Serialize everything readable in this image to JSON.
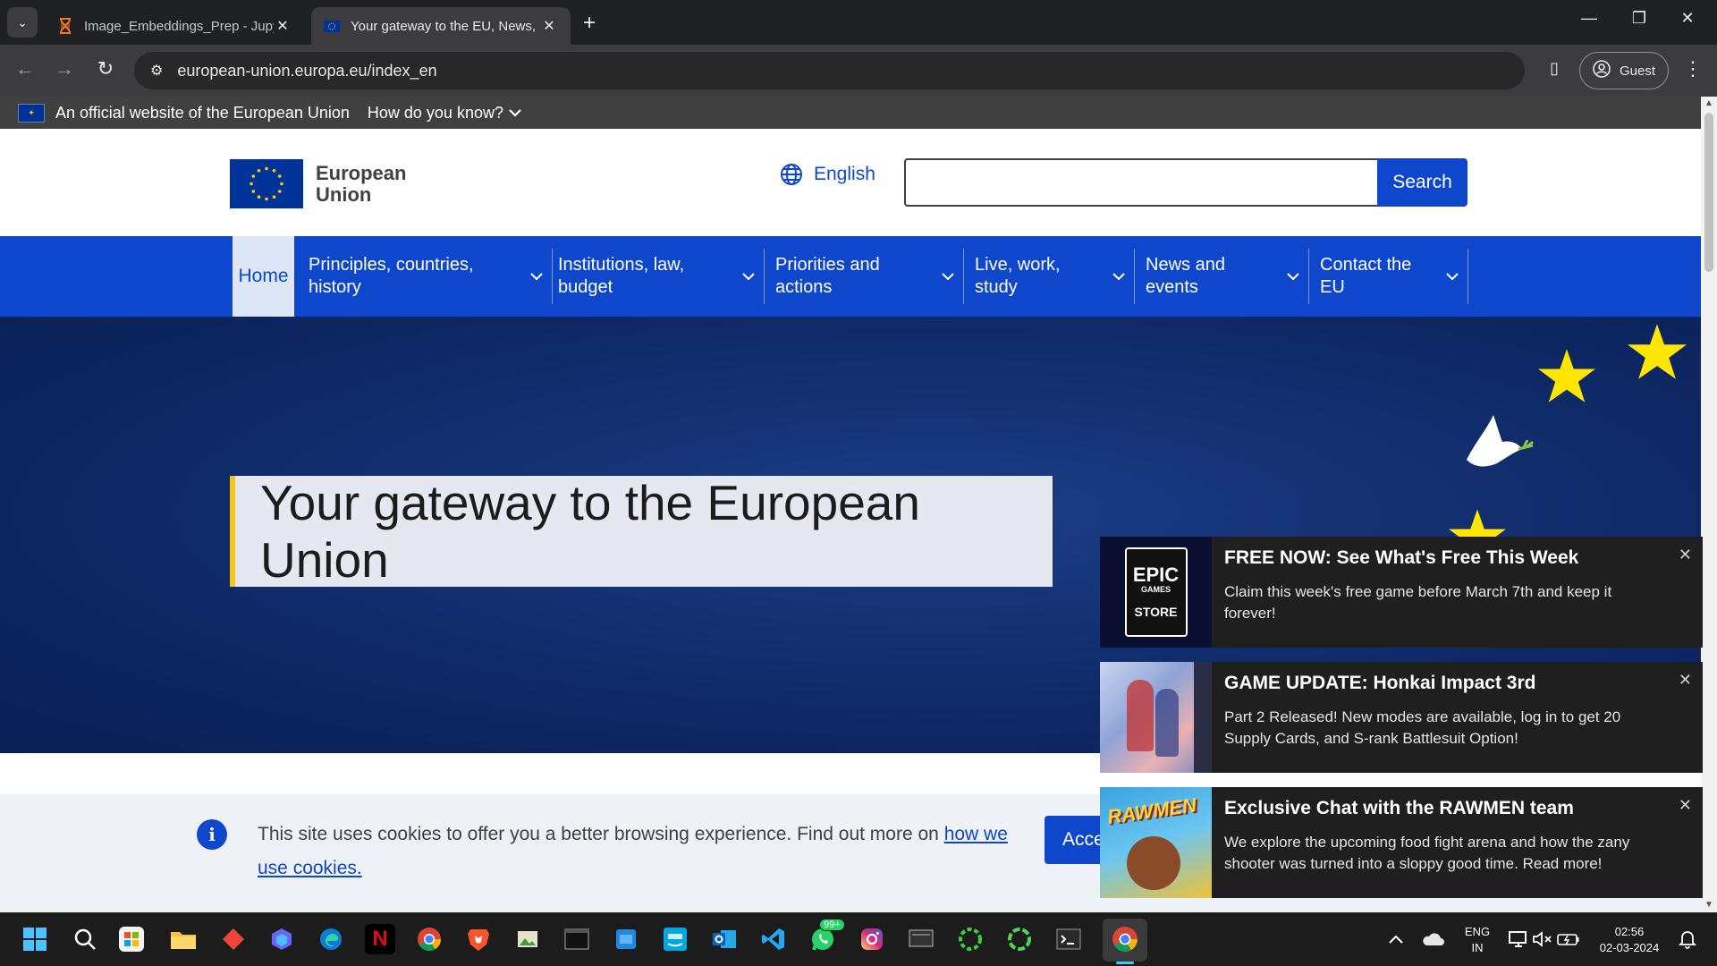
{
  "browser": {
    "tabs": [
      {
        "title": "Image_Embeddings_Prep - Jupy",
        "favicon": "hourglass-icon"
      },
      {
        "title": "Your gateway to the EU, News, ",
        "favicon": "eu-flag-icon"
      }
    ],
    "url": "european-union.europa.eu/index_en",
    "profile_label": "Guest"
  },
  "site": {
    "official_notice": "An official website of the European Union",
    "how_do_you_know": "How do you know?",
    "logo_line1": "European",
    "logo_line2": "Union",
    "language": "English",
    "search_placeholder": "",
    "search_button": "Search",
    "nav": {
      "home": "Home",
      "items": [
        {
          "line1": "Principles, countries,",
          "line2": "history"
        },
        {
          "line1": "Institutions, law,",
          "line2": "budget"
        },
        {
          "line1": "Priorities and",
          "line2": "actions"
        },
        {
          "line1": "Live, work,",
          "line2": "study"
        },
        {
          "line1": "News and",
          "line2": "events"
        },
        {
          "line1": "Contact the",
          "line2": "EU"
        }
      ]
    },
    "hero_title": "Your gateway to the European Union",
    "cookie": {
      "text": "This site uses cookies to offer you a better browsing experience. Find out more on ",
      "link_text": "how we use cookies.",
      "accept_label": "Acce"
    }
  },
  "notifications": [
    {
      "title": "FREE NOW: See What's Free This Week",
      "message": "Claim this week's free game before March 7th and keep it forever!",
      "thumb_line1": "EPIC",
      "thumb_line2": "GAMES",
      "thumb_line3": "STORE"
    },
    {
      "title": "GAME UPDATE: Honkai Impact 3rd",
      "message": "Part 2 Released! New modes are available, log in to get 20 Supply Cards, and S-rank Battlesuit Option!"
    },
    {
      "title": "Exclusive Chat with the RAWMEN team",
      "message": "We explore the upcoming food fight arena and how the zany shooter was turned into a sloppy good time. Read more!",
      "thumb_text": "RAWMEN"
    }
  ],
  "taskbar": {
    "whatsapp_badge": "99+",
    "lang_line1": "ENG",
    "lang_line2": "IN",
    "time": "02:56",
    "date": "02-03-2024",
    "netflix_letter": "N"
  },
  "colors": {
    "eu_blue": "#0e47cb",
    "eu_flag_blue": "#003399",
    "eu_yellow": "#ffcc00",
    "hero_bg": "#0f2a68"
  }
}
